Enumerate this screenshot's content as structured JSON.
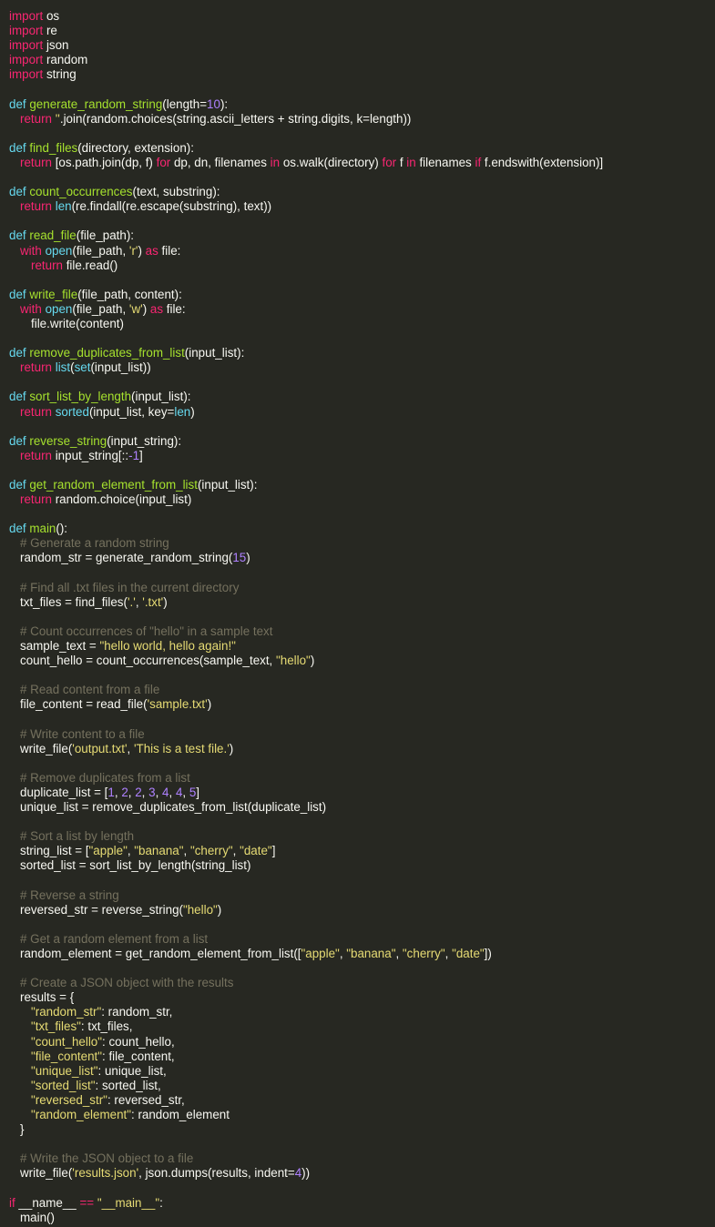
{
  "editor": {
    "colors": {
      "background": "#272822",
      "text": "#f8f8f2",
      "keyword": "#f92672",
      "function_name": "#a6e22e",
      "builtin": "#66d9ef",
      "string": "#e6db74",
      "number": "#ae81ff",
      "comment": "#75715e"
    },
    "lines": [
      {
        "indent": 0,
        "tokens": [
          [
            "kw",
            "import"
          ],
          [
            "tx",
            " os"
          ]
        ]
      },
      {
        "indent": 0,
        "tokens": [
          [
            "kw",
            "import"
          ],
          [
            "tx",
            " re"
          ]
        ]
      },
      {
        "indent": 0,
        "tokens": [
          [
            "kw",
            "import"
          ],
          [
            "tx",
            " json"
          ]
        ]
      },
      {
        "indent": 0,
        "tokens": [
          [
            "kw",
            "import"
          ],
          [
            "tx",
            " random"
          ]
        ]
      },
      {
        "indent": 0,
        "tokens": [
          [
            "kw",
            "import"
          ],
          [
            "tx",
            " string"
          ]
        ]
      },
      {
        "indent": 0,
        "tokens": []
      },
      {
        "indent": 0,
        "tokens": [
          [
            "bi",
            "def"
          ],
          [
            "tx",
            " "
          ],
          [
            "fn",
            "generate_random_string"
          ],
          [
            "tx",
            "(length="
          ],
          [
            "num",
            "10"
          ],
          [
            "tx",
            "):"
          ]
        ]
      },
      {
        "indent": 1,
        "tokens": [
          [
            "kw",
            "return"
          ],
          [
            "tx",
            " "
          ],
          [
            "str",
            "''"
          ],
          [
            "tx",
            ".join(random.choices(string.ascii_letters + string.digits, k=length))"
          ]
        ]
      },
      {
        "indent": 0,
        "tokens": []
      },
      {
        "indent": 0,
        "tokens": [
          [
            "bi",
            "def"
          ],
          [
            "tx",
            " "
          ],
          [
            "fn",
            "find_files"
          ],
          [
            "tx",
            "(directory, extension):"
          ]
        ]
      },
      {
        "indent": 1,
        "tokens": [
          [
            "kw",
            "return"
          ],
          [
            "tx",
            " [os.path.join(dp, f) "
          ],
          [
            "kw",
            "for"
          ],
          [
            "tx",
            " dp, dn, filenames "
          ],
          [
            "kw",
            "in"
          ],
          [
            "tx",
            " os.walk(directory) "
          ],
          [
            "kw",
            "for"
          ],
          [
            "tx",
            " f "
          ],
          [
            "kw",
            "in"
          ],
          [
            "tx",
            " filenames "
          ],
          [
            "kw",
            "if"
          ],
          [
            "tx",
            " f.endswith(extension)]"
          ]
        ]
      },
      {
        "indent": 0,
        "tokens": []
      },
      {
        "indent": 0,
        "tokens": [
          [
            "bi",
            "def"
          ],
          [
            "tx",
            " "
          ],
          [
            "fn",
            "count_occurrences"
          ],
          [
            "tx",
            "(text, substring):"
          ]
        ]
      },
      {
        "indent": 1,
        "tokens": [
          [
            "kw",
            "return"
          ],
          [
            "tx",
            " "
          ],
          [
            "bi",
            "len"
          ],
          [
            "tx",
            "(re.findall(re.escape(substring), text))"
          ]
        ]
      },
      {
        "indent": 0,
        "tokens": []
      },
      {
        "indent": 0,
        "tokens": [
          [
            "bi",
            "def"
          ],
          [
            "tx",
            " "
          ],
          [
            "fn",
            "read_file"
          ],
          [
            "tx",
            "(file_path):"
          ]
        ]
      },
      {
        "indent": 1,
        "tokens": [
          [
            "kw",
            "with"
          ],
          [
            "tx",
            " "
          ],
          [
            "bi",
            "open"
          ],
          [
            "tx",
            "(file_path, "
          ],
          [
            "str",
            "'r'"
          ],
          [
            "tx",
            ") "
          ],
          [
            "kw",
            "as"
          ],
          [
            "tx",
            " file:"
          ]
        ]
      },
      {
        "indent": 2,
        "tokens": [
          [
            "kw",
            "return"
          ],
          [
            "tx",
            " file.read()"
          ]
        ]
      },
      {
        "indent": 0,
        "tokens": []
      },
      {
        "indent": 0,
        "tokens": [
          [
            "bi",
            "def"
          ],
          [
            "tx",
            " "
          ],
          [
            "fn",
            "write_file"
          ],
          [
            "tx",
            "(file_path, content):"
          ]
        ]
      },
      {
        "indent": 1,
        "tokens": [
          [
            "kw",
            "with"
          ],
          [
            "tx",
            " "
          ],
          [
            "bi",
            "open"
          ],
          [
            "tx",
            "(file_path, "
          ],
          [
            "str",
            "'w'"
          ],
          [
            "tx",
            ") "
          ],
          [
            "kw",
            "as"
          ],
          [
            "tx",
            " file:"
          ]
        ]
      },
      {
        "indent": 2,
        "tokens": [
          [
            "tx",
            "file.write(content)"
          ]
        ]
      },
      {
        "indent": 0,
        "tokens": []
      },
      {
        "indent": 0,
        "tokens": [
          [
            "bi",
            "def"
          ],
          [
            "tx",
            " "
          ],
          [
            "fn",
            "remove_duplicates_from_list"
          ],
          [
            "tx",
            "(input_list):"
          ]
        ]
      },
      {
        "indent": 1,
        "tokens": [
          [
            "kw",
            "return"
          ],
          [
            "tx",
            " "
          ],
          [
            "bi",
            "list"
          ],
          [
            "tx",
            "("
          ],
          [
            "bi",
            "set"
          ],
          [
            "tx",
            "(input_list))"
          ]
        ]
      },
      {
        "indent": 0,
        "tokens": []
      },
      {
        "indent": 0,
        "tokens": [
          [
            "bi",
            "def"
          ],
          [
            "tx",
            " "
          ],
          [
            "fn",
            "sort_list_by_length"
          ],
          [
            "tx",
            "(input_list):"
          ]
        ]
      },
      {
        "indent": 1,
        "tokens": [
          [
            "kw",
            "return"
          ],
          [
            "tx",
            " "
          ],
          [
            "bi",
            "sorted"
          ],
          [
            "tx",
            "(input_list, key="
          ],
          [
            "bi",
            "len"
          ],
          [
            "tx",
            ")"
          ]
        ]
      },
      {
        "indent": 0,
        "tokens": []
      },
      {
        "indent": 0,
        "tokens": [
          [
            "bi",
            "def"
          ],
          [
            "tx",
            " "
          ],
          [
            "fn",
            "reverse_string"
          ],
          [
            "tx",
            "(input_string):"
          ]
        ]
      },
      {
        "indent": 1,
        "tokens": [
          [
            "kw",
            "return"
          ],
          [
            "tx",
            " input_string[::"
          ],
          [
            "num",
            "-1"
          ],
          [
            "tx",
            "]"
          ]
        ]
      },
      {
        "indent": 0,
        "tokens": []
      },
      {
        "indent": 0,
        "tokens": [
          [
            "bi",
            "def"
          ],
          [
            "tx",
            " "
          ],
          [
            "fn",
            "get_random_element_from_list"
          ],
          [
            "tx",
            "(input_list):"
          ]
        ]
      },
      {
        "indent": 1,
        "tokens": [
          [
            "kw",
            "return"
          ],
          [
            "tx",
            " random.choice(input_list)"
          ]
        ]
      },
      {
        "indent": 0,
        "tokens": []
      },
      {
        "indent": 0,
        "tokens": [
          [
            "bi",
            "def"
          ],
          [
            "tx",
            " "
          ],
          [
            "fn",
            "main"
          ],
          [
            "tx",
            "():"
          ]
        ]
      },
      {
        "indent": 1,
        "tokens": [
          [
            "cm",
            "# Generate a random string"
          ]
        ]
      },
      {
        "indent": 1,
        "tokens": [
          [
            "tx",
            "random_str = generate_random_string("
          ],
          [
            "num",
            "15"
          ],
          [
            "tx",
            ")"
          ]
        ]
      },
      {
        "indent": 0,
        "tokens": []
      },
      {
        "indent": 1,
        "tokens": [
          [
            "cm",
            "# Find all .txt files in the current directory"
          ]
        ]
      },
      {
        "indent": 1,
        "tokens": [
          [
            "tx",
            "txt_files = find_files("
          ],
          [
            "str",
            "'.'"
          ],
          [
            "tx",
            ", "
          ],
          [
            "str",
            "'.txt'"
          ],
          [
            "tx",
            ")"
          ]
        ]
      },
      {
        "indent": 0,
        "tokens": []
      },
      {
        "indent": 1,
        "tokens": [
          [
            "cm",
            "# Count occurrences of \"hello\" in a sample text"
          ]
        ]
      },
      {
        "indent": 1,
        "tokens": [
          [
            "tx",
            "sample_text = "
          ],
          [
            "str",
            "\"hello world, hello again!\""
          ]
        ]
      },
      {
        "indent": 1,
        "tokens": [
          [
            "tx",
            "count_hello = count_occurrences(sample_text, "
          ],
          [
            "str",
            "\"hello\""
          ],
          [
            "tx",
            ")"
          ]
        ]
      },
      {
        "indent": 0,
        "tokens": []
      },
      {
        "indent": 1,
        "tokens": [
          [
            "cm",
            "# Read content from a file"
          ]
        ]
      },
      {
        "indent": 1,
        "tokens": [
          [
            "tx",
            "file_content = read_file("
          ],
          [
            "str",
            "'sample.txt'"
          ],
          [
            "tx",
            ")"
          ]
        ]
      },
      {
        "indent": 0,
        "tokens": []
      },
      {
        "indent": 1,
        "tokens": [
          [
            "cm",
            "# Write content to a file"
          ]
        ]
      },
      {
        "indent": 1,
        "tokens": [
          [
            "tx",
            "write_file("
          ],
          [
            "str",
            "'output.txt'"
          ],
          [
            "tx",
            ", "
          ],
          [
            "str",
            "'This is a test file.'"
          ],
          [
            "tx",
            ")"
          ]
        ]
      },
      {
        "indent": 0,
        "tokens": []
      },
      {
        "indent": 1,
        "tokens": [
          [
            "cm",
            "# Remove duplicates from a list"
          ]
        ]
      },
      {
        "indent": 1,
        "tokens": [
          [
            "tx",
            "duplicate_list = ["
          ],
          [
            "num",
            "1"
          ],
          [
            "tx",
            ", "
          ],
          [
            "num",
            "2"
          ],
          [
            "tx",
            ", "
          ],
          [
            "num",
            "2"
          ],
          [
            "tx",
            ", "
          ],
          [
            "num",
            "3"
          ],
          [
            "tx",
            ", "
          ],
          [
            "num",
            "4"
          ],
          [
            "tx",
            ", "
          ],
          [
            "num",
            "4"
          ],
          [
            "tx",
            ", "
          ],
          [
            "num",
            "5"
          ],
          [
            "tx",
            "]"
          ]
        ]
      },
      {
        "indent": 1,
        "tokens": [
          [
            "tx",
            "unique_list = remove_duplicates_from_list(duplicate_list)"
          ]
        ]
      },
      {
        "indent": 0,
        "tokens": []
      },
      {
        "indent": 1,
        "tokens": [
          [
            "cm",
            "# Sort a list by length"
          ]
        ]
      },
      {
        "indent": 1,
        "tokens": [
          [
            "tx",
            "string_list = ["
          ],
          [
            "str",
            "\"apple\""
          ],
          [
            "tx",
            ", "
          ],
          [
            "str",
            "\"banana\""
          ],
          [
            "tx",
            ", "
          ],
          [
            "str",
            "\"cherry\""
          ],
          [
            "tx",
            ", "
          ],
          [
            "str",
            "\"date\""
          ],
          [
            "tx",
            "]"
          ]
        ]
      },
      {
        "indent": 1,
        "tokens": [
          [
            "tx",
            "sorted_list = sort_list_by_length(string_list)"
          ]
        ]
      },
      {
        "indent": 0,
        "tokens": []
      },
      {
        "indent": 1,
        "tokens": [
          [
            "cm",
            "# Reverse a string"
          ]
        ]
      },
      {
        "indent": 1,
        "tokens": [
          [
            "tx",
            "reversed_str = reverse_string("
          ],
          [
            "str",
            "\"hello\""
          ],
          [
            "tx",
            ")"
          ]
        ]
      },
      {
        "indent": 0,
        "tokens": []
      },
      {
        "indent": 1,
        "tokens": [
          [
            "cm",
            "# Get a random element from a list"
          ]
        ]
      },
      {
        "indent": 1,
        "tokens": [
          [
            "tx",
            "random_element = get_random_element_from_list(["
          ],
          [
            "str",
            "\"apple\""
          ],
          [
            "tx",
            ", "
          ],
          [
            "str",
            "\"banana\""
          ],
          [
            "tx",
            ", "
          ],
          [
            "str",
            "\"cherry\""
          ],
          [
            "tx",
            ", "
          ],
          [
            "str",
            "\"date\""
          ],
          [
            "tx",
            "])"
          ]
        ]
      },
      {
        "indent": 0,
        "tokens": []
      },
      {
        "indent": 1,
        "tokens": [
          [
            "cm",
            "# Create a JSON object with the results"
          ]
        ]
      },
      {
        "indent": 1,
        "tokens": [
          [
            "tx",
            "results = {"
          ]
        ]
      },
      {
        "indent": 2,
        "tokens": [
          [
            "str",
            "\"random_str\""
          ],
          [
            "tx",
            ": random_str,"
          ]
        ]
      },
      {
        "indent": 2,
        "tokens": [
          [
            "str",
            "\"txt_files\""
          ],
          [
            "tx",
            ": txt_files,"
          ]
        ]
      },
      {
        "indent": 2,
        "tokens": [
          [
            "str",
            "\"count_hello\""
          ],
          [
            "tx",
            ": count_hello,"
          ]
        ]
      },
      {
        "indent": 2,
        "tokens": [
          [
            "str",
            "\"file_content\""
          ],
          [
            "tx",
            ": file_content,"
          ]
        ]
      },
      {
        "indent": 2,
        "tokens": [
          [
            "str",
            "\"unique_list\""
          ],
          [
            "tx",
            ": unique_list,"
          ]
        ]
      },
      {
        "indent": 2,
        "tokens": [
          [
            "str",
            "\"sorted_list\""
          ],
          [
            "tx",
            ": sorted_list,"
          ]
        ]
      },
      {
        "indent": 2,
        "tokens": [
          [
            "str",
            "\"reversed_str\""
          ],
          [
            "tx",
            ": reversed_str,"
          ]
        ]
      },
      {
        "indent": 2,
        "tokens": [
          [
            "str",
            "\"random_element\""
          ],
          [
            "tx",
            ": random_element"
          ]
        ]
      },
      {
        "indent": 1,
        "tokens": [
          [
            "tx",
            "}"
          ]
        ]
      },
      {
        "indent": 0,
        "tokens": []
      },
      {
        "indent": 1,
        "tokens": [
          [
            "cm",
            "# Write the JSON object to a file"
          ]
        ]
      },
      {
        "indent": 1,
        "tokens": [
          [
            "tx",
            "write_file("
          ],
          [
            "str",
            "'results.json'"
          ],
          [
            "tx",
            ", json.dumps(results, indent="
          ],
          [
            "num",
            "4"
          ],
          [
            "tx",
            "))"
          ]
        ]
      },
      {
        "indent": 0,
        "tokens": []
      },
      {
        "indent": 0,
        "tokens": [
          [
            "kw",
            "if"
          ],
          [
            "tx",
            " __name__ "
          ],
          [
            "kw",
            "=="
          ],
          [
            "tx",
            " "
          ],
          [
            "str",
            "\"__main__\""
          ],
          [
            "tx",
            ":"
          ]
        ]
      },
      {
        "indent": 1,
        "tokens": [
          [
            "tx",
            "main()"
          ]
        ]
      }
    ]
  }
}
